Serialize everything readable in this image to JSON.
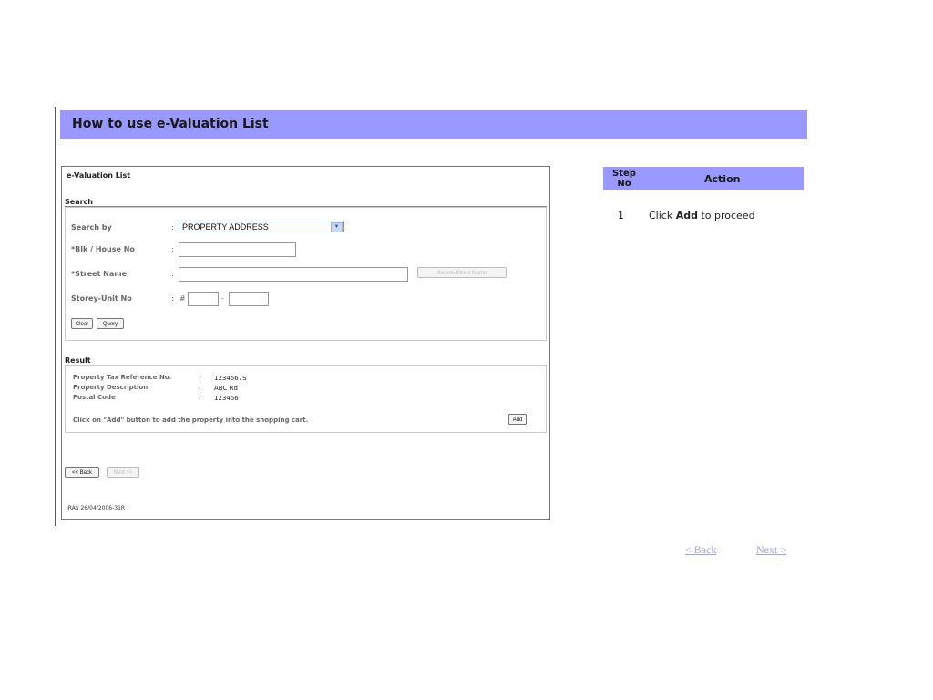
{
  "banner": {
    "title": "How to use e-Valuation List"
  },
  "screenshot": {
    "title": "e-Valuation List",
    "search": {
      "section_label": "Search",
      "search_by_label": "Search by",
      "search_by_value": "PROPERTY ADDRESS",
      "blk_label": "*Blk / House No",
      "street_label": "*Street Name",
      "search_street_button": "Search Street Name",
      "storey_label": "Storey-Unit No",
      "hash": "#",
      "dash": "-",
      "colon": ":",
      "clear_button": "Clear",
      "query_button": "Query"
    },
    "result": {
      "section_label": "Result",
      "rows": [
        {
          "label": "Property Tax Reference No.",
          "value": "1234567S"
        },
        {
          "label": "Property Description",
          "value": "ABC Rd"
        },
        {
          "label": "Postal Code",
          "value": "123456"
        }
      ],
      "instruction": "Click on \"Add\" button to add the property into the shopping cart.",
      "add_button": "Add"
    },
    "back_button": "<< Back",
    "next_button": "Next >>",
    "footer": "IRAS 26/04/2006-31R"
  },
  "steps": {
    "header_step": "Step No",
    "header_action": "Action",
    "rows": [
      {
        "no": "1",
        "pre": "Click ",
        "bold": "Add",
        "post": " to proceed"
      }
    ]
  },
  "nav": {
    "back": "< Back",
    "next": "Next >"
  }
}
